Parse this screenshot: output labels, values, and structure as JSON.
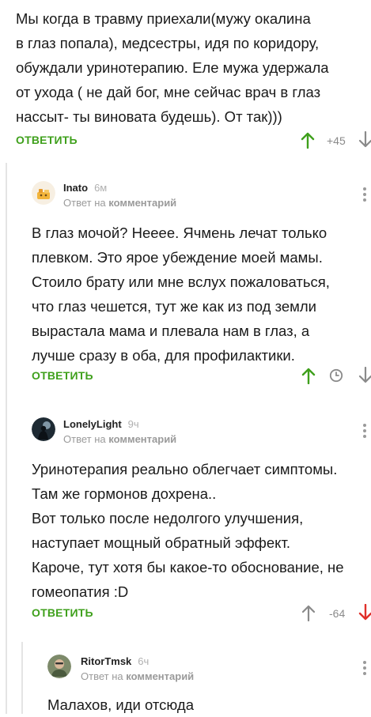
{
  "colors": {
    "accent": "#3fa01c",
    "downvote": "#e0302a",
    "muted": "#9a9a9a"
  },
  "top_comment": {
    "lines": [
      "Мы когда в травму приехали(мужу окалина",
      "в глаз попала), медсестры, идя по коридору,",
      "обуждали уринотерапию. Еле мужа удержала",
      "от ухода ( не дай бог, мне сейчас врач в глаз",
      "нассыт- ты виновата будешь). От так)))"
    ],
    "reply_label": "ОТВЕТИТЬ",
    "rating": "+45"
  },
  "comments": [
    {
      "username": "Inato",
      "time": "6м",
      "reply_to_prefix": "Ответ на",
      "reply_to_target": "комментарий",
      "lines": [
        "В глаз мочой? Нееее. Ячмень лечат только",
        "плевком. Это ярое убеждение моей мамы.",
        "Стоило брату или мне вслух пожаловаться,",
        "что глаз чешется, тут же как из под земли",
        "вырастала мама и плевала нам в глаз, а",
        "лучше сразу в оба, для профилактики."
      ],
      "reply_label": "ОТВЕТИТЬ",
      "icons": [
        "upvote-arrow-icon",
        "clock-icon",
        "downvote-arrow-icon",
        "more-icon"
      ]
    },
    {
      "username": "LonelyLight",
      "time": "9ч",
      "reply_to_prefix": "Ответ на",
      "reply_to_target": "комментарий",
      "lines": [
        "Уринотерапия реально облегчает симптомы.",
        "Там же гормонов дохрена..",
        "Вот только после недолгого улучшения,",
        "наступает мощный обратный эффект.",
        "Кароче, тут хотя бы какое-то обоснование, не",
        "гомеопатия :D"
      ],
      "reply_label": "ОТВЕТИТЬ",
      "rating": "-64",
      "icons": [
        "upvote-arrow-icon",
        "downvote-arrow-icon",
        "more-icon"
      ]
    },
    {
      "username": "RitorTmsk",
      "time": "6ч",
      "reply_to_prefix": "Ответ на",
      "reply_to_target": "комментарий",
      "lines": [
        "Малахов, иди отсюда"
      ],
      "icons": [
        "more-icon"
      ]
    }
  ]
}
